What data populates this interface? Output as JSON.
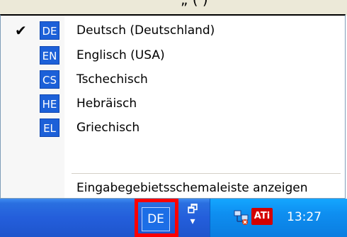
{
  "top_strip": {
    "partial_text": "„ (  )"
  },
  "menu": {
    "items": [
      {
        "code": "DE",
        "label": "Deutsch (Deutschland)",
        "checked": true,
        "check_glyph": "✔"
      },
      {
        "code": "EN",
        "label": "Englisch (USA)",
        "checked": false
      },
      {
        "code": "CS",
        "label": "Tschechisch",
        "checked": false
      },
      {
        "code": "HE",
        "label": "Hebräisch",
        "checked": false
      },
      {
        "code": "EL",
        "label": "Griechisch",
        "checked": false
      }
    ],
    "show_bar_label": "Eingabegebietsschemaleiste anzeigen"
  },
  "taskbar": {
    "ime_button_label": "DE",
    "lang_bar_icon": "restore-language-bar-icon",
    "tray": {
      "icons": [
        "network-icon",
        "ati-icon"
      ],
      "ati_label": "ATi",
      "clock": "13:27"
    }
  },
  "colors": {
    "badge_blue": "#1c60d8",
    "highlight_red": "#ff0000",
    "taskbar_blue": "#245edb",
    "tray_blue": "#0e8ef0"
  }
}
